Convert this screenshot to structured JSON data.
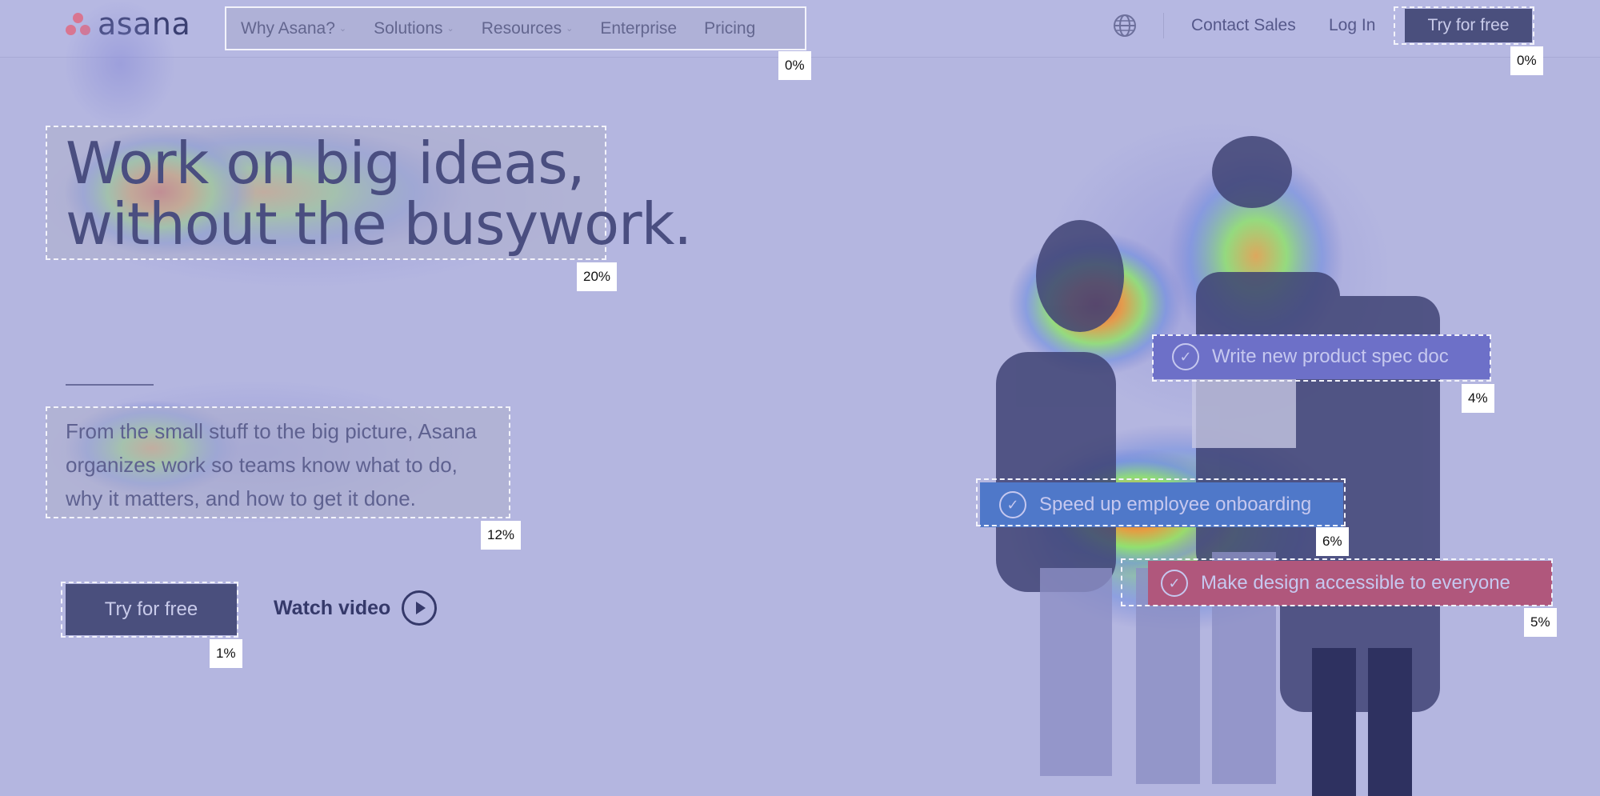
{
  "header": {
    "logo_text": "asana",
    "nav": [
      {
        "label": "Why Asana?",
        "has_dropdown": true
      },
      {
        "label": "Solutions",
        "has_dropdown": true
      },
      {
        "label": "Resources",
        "has_dropdown": true
      },
      {
        "label": "Enterprise",
        "has_dropdown": false
      },
      {
        "label": "Pricing",
        "has_dropdown": false
      }
    ],
    "globe_icon": "globe-icon",
    "contact_sales": "Contact Sales",
    "log_in": "Log In",
    "try_for_free": "Try for free"
  },
  "hero": {
    "headline_line1": "Work on big ideas,",
    "headline_line2": "without the busywork.",
    "subtext_line1": "From the small stuff to the big picture, Asana",
    "subtext_line2": "organizes work so teams know what to do,",
    "subtext_line3": "why it matters, and how to get it done.",
    "cta_primary": "Try for free",
    "cta_secondary": "Watch video"
  },
  "tasks": [
    {
      "label": "Write new product spec doc",
      "color": "#6d70c8"
    },
    {
      "label": "Speed up employee onboarding",
      "color": "#4f78c9"
    },
    {
      "label": "Make design accessible to everyone",
      "color": "#b0577c"
    }
  ],
  "heatmap_aoi": {
    "nav_menu": "0%",
    "try_for_free_top": "0%",
    "headline": "20%",
    "subtext": "12%",
    "try_for_free_hero": "1%",
    "task_spec_doc": "4%",
    "task_onboarding": "6%",
    "task_design": "5%"
  }
}
